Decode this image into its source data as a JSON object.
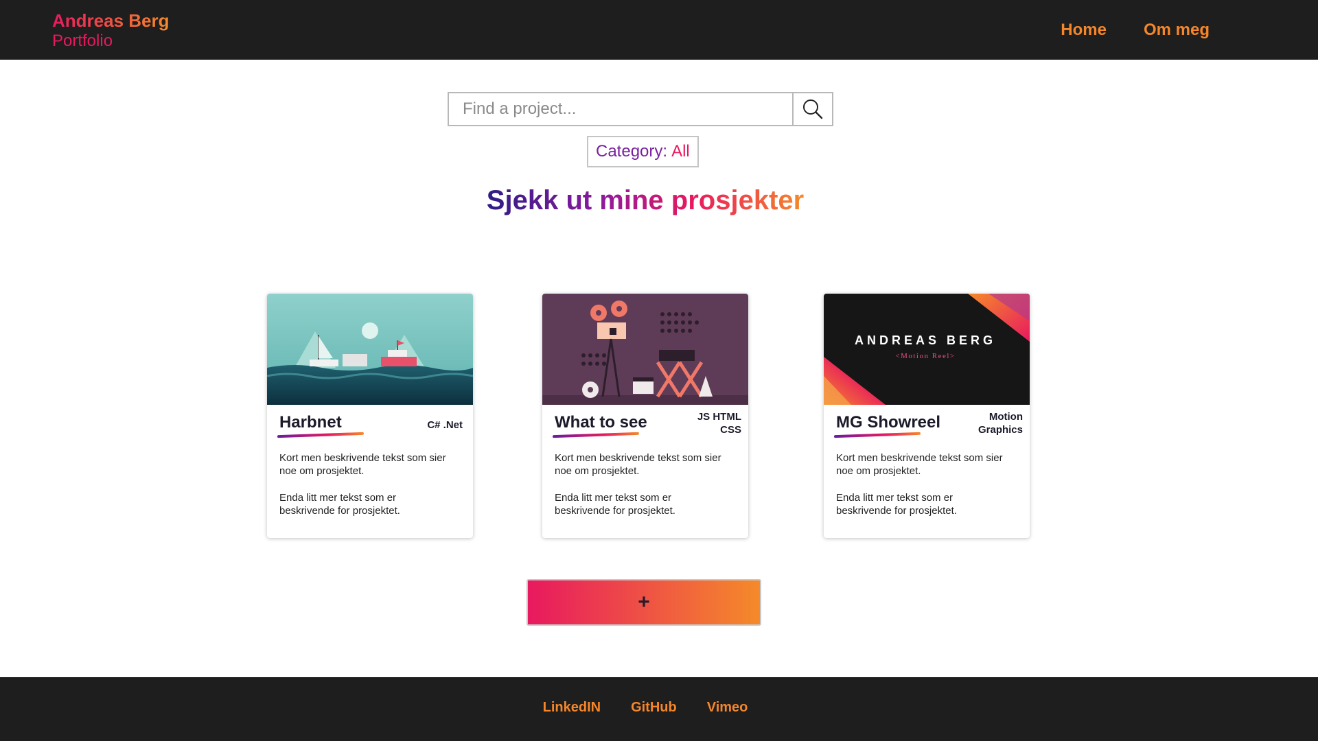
{
  "header": {
    "brand_name": "Andreas Berg",
    "brand_subtitle": "Portfolio",
    "nav": [
      {
        "label": "Home"
      },
      {
        "label": "Om meg"
      }
    ]
  },
  "search": {
    "placeholder": "Find a project...",
    "value": "",
    "icon": "search-icon"
  },
  "category": {
    "label": "Category:",
    "value": "All"
  },
  "heading": "Sjekk ut mine prosjekter",
  "projects": [
    {
      "title": "Harbnet",
      "tags": "C# .Net",
      "tags_line2": "",
      "desc1": "Kort men beskrivende tekst som sier noe om prosjektet.",
      "desc2": "Enda litt mer tekst som er beskrivende for prosjektet."
    },
    {
      "title": "What to see",
      "tags": "JS HTML",
      "tags_line2": "CSS",
      "desc1": "Kort men beskrivende tekst som sier noe om prosjektet.",
      "desc2": "Enda litt mer tekst som er beskrivende for prosjektet."
    },
    {
      "title": "MG Showreel",
      "tags": "Motion",
      "tags_line2": "Graphics",
      "desc1": "Kort men beskrivende tekst som sier noe om prosjektet.",
      "desc2": "Enda litt mer tekst som er beskrivende for prosjektet.",
      "image_title": "ANDREAS BERG",
      "image_subtitle": "<Motion Reel>"
    }
  ],
  "add_button": "+",
  "footer": {
    "links": [
      {
        "label": "LinkedIN"
      },
      {
        "label": "GitHub"
      },
      {
        "label": "Vimeo"
      }
    ]
  },
  "colors": {
    "header_bg": "#1e1e1e",
    "accent_orange": "#f5862a",
    "accent_pink": "#e8195f",
    "accent_purple": "#7a1fa2"
  }
}
